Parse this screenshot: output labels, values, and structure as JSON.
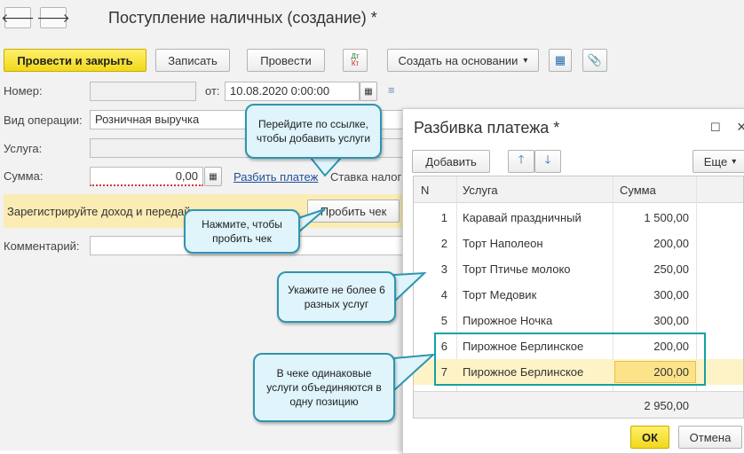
{
  "window": {
    "title": "Поступление наличных (создание) *"
  },
  "nav": {
    "back_glyph": "🡐",
    "forward_glyph": "🡒"
  },
  "toolbar": {
    "post_close": "Провести и закрыть",
    "save": "Записать",
    "post": "Провести",
    "dt_kt_top": "Дт",
    "dt_kt_bottom": "Кт",
    "create_basis": "Создать на основании",
    "dropdown_glyph": "▾",
    "structure_glyph": "▦",
    "attach_glyph": "📎"
  },
  "form": {
    "number_label": "Номер:",
    "number_value": "",
    "date_label": "от:",
    "date_value": "10.08.2020  0:00:00",
    "calendar_glyph": "▦",
    "notes_glyph": "≡",
    "operation_label": "Вид операции:",
    "operation_value": "Розничная выручка",
    "service_label": "Услуга:",
    "service_value": "",
    "sum_label": "Сумма:",
    "sum_value": "0,00",
    "calc_glyph": "▦",
    "split_link": "Разбить платеж",
    "tax_label": "Ставка налог",
    "banner_text": "Зарегистрируйте доход и передай",
    "punch_button": "Пробить чек",
    "comment_label": "Комментарий:",
    "comment_value": ""
  },
  "panel": {
    "title": "Разбивка платежа *",
    "maximize_glyph": "☐",
    "close_glyph": "×",
    "add_button": "Добавить",
    "up_glyph": "🡑",
    "down_glyph": "🡓",
    "more_button": "Еще",
    "more_glyph": "▾",
    "columns": {
      "n": "N",
      "service": "Услуга",
      "sum": "Сумма"
    },
    "rows": [
      {
        "n": "1",
        "service": "Каравай праздничный",
        "sum": "1 500,00"
      },
      {
        "n": "2",
        "service": "Торт Наполеон",
        "sum": "200,00"
      },
      {
        "n": "3",
        "service": "Торт Птичье молоко",
        "sum": "250,00"
      },
      {
        "n": "4",
        "service": "Торт Медовик",
        "sum": "300,00"
      },
      {
        "n": "5",
        "service": "Пирожное Ночка",
        "sum": "300,00"
      },
      {
        "n": "6",
        "service": "Пирожное Берлинское",
        "sum": "200,00"
      },
      {
        "n": "7",
        "service": "Пирожное Берлинское",
        "sum": "200,00"
      }
    ],
    "total": "2 950,00",
    "ok_button": "ОК",
    "cancel_button": "Отмена"
  },
  "callouts": {
    "link_hint": "Перейдите по ссылке, чтобы добавить услуги",
    "punch_hint": "Нажмите, чтобы пробить чек",
    "limit_hint": "Укажите не более 6 разных услуг",
    "merge_hint": "В чеке одинаковые услуги объединяются в одну позицию"
  },
  "colors": {
    "accent_yellow": "#f2d81c",
    "callout_border": "#2f95b0",
    "highlight_border": "#15a2a2",
    "selected_row": "#fdf3c6"
  }
}
